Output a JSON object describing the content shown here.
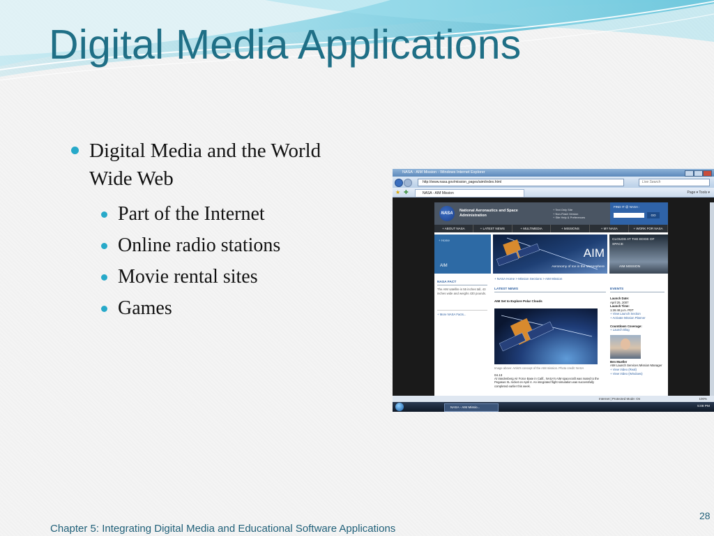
{
  "slide": {
    "title": "Digital Media Applications",
    "bullets": [
      {
        "text": "Digital Media and the World Wide Web"
      },
      {
        "text": "Part of the Internet"
      },
      {
        "text": "Online radio stations"
      },
      {
        "text": "Movie rental sites"
      },
      {
        "text": "Games"
      }
    ],
    "footer": "Chapter 5: Integrating Digital Media and Educational Software Applications",
    "page_number": "28"
  },
  "browser": {
    "window_title": "NASA - AIM Mission - Windows Internet Explorer",
    "url": "http://www.nasa.gov/mission_pages/aim/index.html",
    "search_placeholder": "Live Search",
    "tab_title": "NASA - AIM Mission",
    "toolbar": "Page ▾  Tools ▾",
    "status_zone": "Internet | Protected Mode: On",
    "zoom": "100%",
    "taskbar_item": "NASA - AIM Missio...",
    "clock": "5:08 PM"
  },
  "nasa_page": {
    "logo": "NASA",
    "agency": "National Aeronautics and Space Administration",
    "utility_links": [
      "+ Text Only Site",
      "+ Non-Flash Version",
      "+ Site Help & Preferences"
    ],
    "find_it": "FIND IT @ NASA :",
    "go": "GO",
    "nav": [
      "+ ABOUT NASA",
      "+ LATEST NEWS",
      "+ MULTIMEDIA",
      "+ MISSIONS",
      "+ MY NASA",
      "+ WORK FOR NASA"
    ],
    "home": "+ Home",
    "aim_label": "AIM",
    "banner_title": "AIM",
    "banner_subtitle": "Aeronomy of Ice in the Mesosphere",
    "clouds_title": "CLOUDS AT THE EDGE OF SPACE",
    "clouds_sub": "AIM MISSION",
    "breadcrumb": "+ NASA Home > Mission Sections > AIM Mission",
    "nasa_fact_head": "NASA FACT",
    "nasa_fact": "The AIM satellite is 55 inches tall, 43 inches wide and weighs 430 pounds.",
    "more_facts": "+ More NASA Facts...",
    "latest_news_head": "LATEST NEWS",
    "story_title": "AIM Set to Explore Polar Clouds",
    "caption": "Image above: Artist's concept of the AIM mission. Photo credit: NASA",
    "story_date": "04.13",
    "story_text": "At Vandenberg Air Force Base in Calif., NASA's AIM spacecraft was mated to the Pegasus XL rocket on April 4. An integrated flight simulation was successfully completed earlier this week.",
    "events_head": "EVENTS",
    "launch_date_label": "Launch Date:",
    "launch_date": "April 25, 2007",
    "launch_time_label": "Launch Time:",
    "launch_time": "1:26:48 p.m. PDT",
    "links1": [
      "+ View Launch Section",
      "+ Activate Mission Planner"
    ],
    "countdown_label": "Countdown Coverage:",
    "launch_blog": "+ Launch Blog",
    "person_name": "Ben Mueller",
    "person_role": "AIM Launch Services Mission Manager",
    "video_links": [
      "+ View Video (Real)",
      "+ View Video (Windows)"
    ]
  },
  "colors": {
    "title": "#1f6f86",
    "bullet": "#27a9c9",
    "footer": "#1f5f78"
  }
}
